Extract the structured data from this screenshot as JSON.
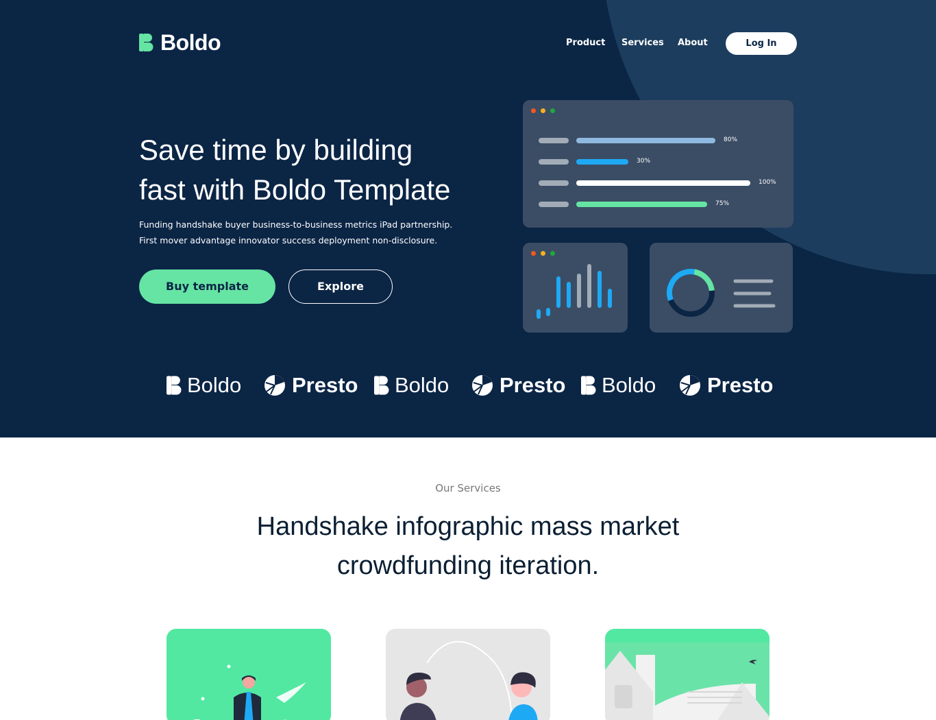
{
  "brand": {
    "name": "Boldo"
  },
  "nav": {
    "items": [
      "Product",
      "Services",
      "About"
    ],
    "login_label": "Log In"
  },
  "hero": {
    "title_line1": "Save time by building",
    "title_line2": "fast with Boldo Template",
    "subtitle_line1": "Funding handshake buyer business-to-business metrics iPad partnership.",
    "subtitle_line2": "First mover advantage innovator success deployment non-disclosure.",
    "buy_label": "Buy template",
    "explore_label": "Explore"
  },
  "dashboard": {
    "progress": [
      {
        "percent": 80,
        "label": "80%",
        "color": "#8fb9e0"
      },
      {
        "percent": 30,
        "label": "30%",
        "color": "#1ea9f5"
      },
      {
        "percent": 100,
        "label": "100%",
        "color": "#ffffff"
      },
      {
        "percent": 75,
        "label": "75%",
        "color": "#65e4a3"
      }
    ],
    "window_dot_colors": [
      "#f2581f",
      "#f2b21f",
      "#1fa83c"
    ]
  },
  "logos": [
    {
      "name": "Boldo",
      "kind": "boldo"
    },
    {
      "name": "Presto",
      "kind": "presto"
    },
    {
      "name": "Boldo",
      "kind": "boldo"
    },
    {
      "name": "Presto",
      "kind": "presto"
    },
    {
      "name": "Boldo",
      "kind": "boldo"
    },
    {
      "name": "Presto",
      "kind": "presto"
    }
  ],
  "services": {
    "eyebrow": "Our Services",
    "title_line1": "Handshake infographic mass market",
    "title_line2": "crowdfunding iteration."
  },
  "colors": {
    "navy": "#0b2545",
    "accent_green": "#65e4a3",
    "accent_blue": "#1ea9f5"
  }
}
